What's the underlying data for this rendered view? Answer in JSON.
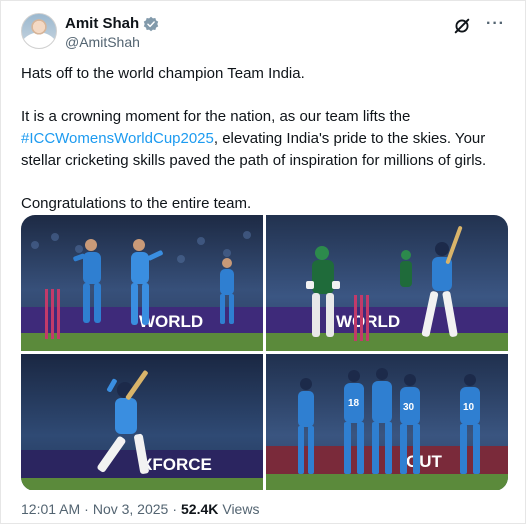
{
  "author": {
    "name": "Amit Shah",
    "handle": "@AmitShah"
  },
  "post": {
    "line1": "Hats off to the world champion Team India.",
    "line2_start": "It is a crowning moment for the nation, as our team lifts the ",
    "hashtag": "#ICCWomensWorldCup2025",
    "line2_end": ", elevating India's pride to the skies. Your stellar cricketing skills paved the path of inspiration for millions of girls.",
    "line3": "Congratulations to the entire team."
  },
  "media": {
    "photo1_banner": "WORLD",
    "photo2_banner": "WORLD",
    "photo3_banner": "XFORCE",
    "photo4_banner": "OUT",
    "jersey_numbers": [
      "18",
      "30",
      "10"
    ]
  },
  "meta": {
    "time": "12:01 AM",
    "sep1": "·",
    "date": "Nov 3, 2025",
    "sep2": "·",
    "views_count": "52.4K",
    "views_label": "Views"
  },
  "colors": {
    "text": "#0f1419",
    "muted": "#536471",
    "link": "#1d9bf0",
    "verified": "#829aab",
    "team_blue": "#2f7fd1"
  },
  "icons": {
    "verified": "verified-badge-icon",
    "grok": "grok-icon",
    "more": "more-options-icon"
  }
}
